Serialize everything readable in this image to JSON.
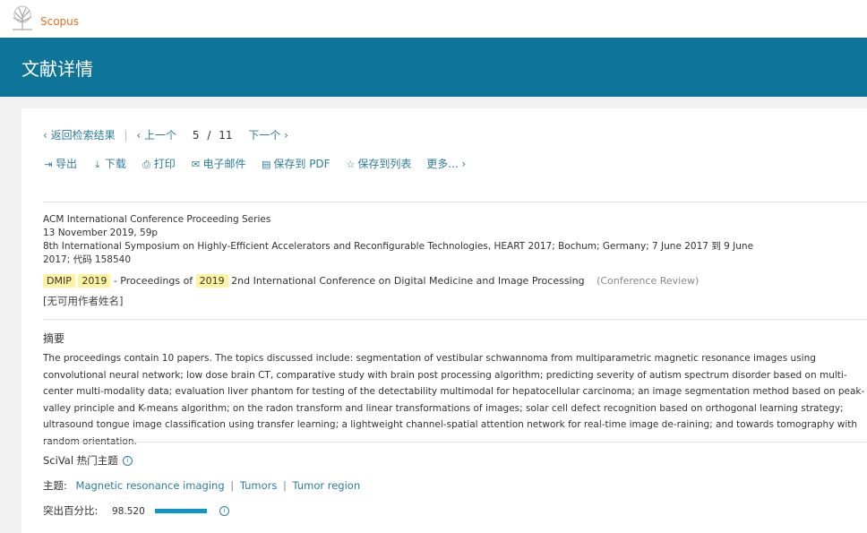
{
  "header": {
    "brand": "Scopus"
  },
  "banner": {
    "title": "文献详情"
  },
  "nav": {
    "back": "返回检索结果",
    "prev": "上一个",
    "current": "5",
    "slash": "/",
    "total": "11",
    "next": "下一个"
  },
  "toolbar": {
    "export": "导出",
    "download": "下载",
    "print": "打印",
    "email": "电子邮件",
    "save_pdf": "保存到 PDF",
    "save_list": "保存到列表",
    "more": "更多..."
  },
  "meta": {
    "series": "ACM International Conference Proceeding Series",
    "date": "13 November 2019, 59p",
    "conference": "8th International Symposium on Highly-Efficient Accelerators and Reconfigurable Technologies, HEART 2017; Bochum; Germany; 7 June 2017 到 9 June",
    "code": "2017; 代码 158540"
  },
  "title": {
    "hl1": "DMIP",
    "hl2": "2019",
    "mid": "- Proceedings of",
    "hl3": "2019",
    "rest": "2nd International Conference on Digital Medicine and Image Processing",
    "doc_type": "(Conference Review)"
  },
  "authors": "[无可用作者姓名]",
  "abstract": {
    "heading": "摘要",
    "text": "The proceedings contain 10 papers. The topics discussed include: segmentation of vestibular schwannoma from multiparametric magnetic resonance images using convolutional neural network; low dose brain CT, comparative study with brain post processing algorithm; predicting severity of autism spectrum disorder based on multi-center multi-modality data; evaluation liver phantom for testing of the detectability multimodal for hepatocellular carcinoma; an image segmentation method based on peak-valley principle and K-means algorithm; on the radon transform and linear transformations of images; solar cell defect recognition based on orthogonal learning strategy; ultrasound tongue image classification using transfer learning; a lightweight channel-spatial attention network for real-time image de-raining; and towards tomography with random orientation."
  },
  "scival": {
    "heading": "SciVal 热门主题",
    "topic_label": "主题:",
    "topics": [
      "Magnetic resonance imaging",
      "Tumors",
      "Tumor region"
    ],
    "topic_sep": "|",
    "percentile_label": "突出百分比:",
    "percentile_value": "98.520",
    "percentile": 98.52
  },
  "colors": {
    "banner": "#0f7598",
    "link": "#2e7d9b",
    "brand": "#e9711c",
    "highlight": "#fdf3a1",
    "bar": "#0f96c8"
  },
  "icons": [
    "scopus-logo-icon",
    "chevron-left-icon",
    "chevron-right-icon",
    "export-icon",
    "download-icon",
    "print-icon",
    "email-icon",
    "pdf-icon",
    "star-icon",
    "info-icon"
  ]
}
